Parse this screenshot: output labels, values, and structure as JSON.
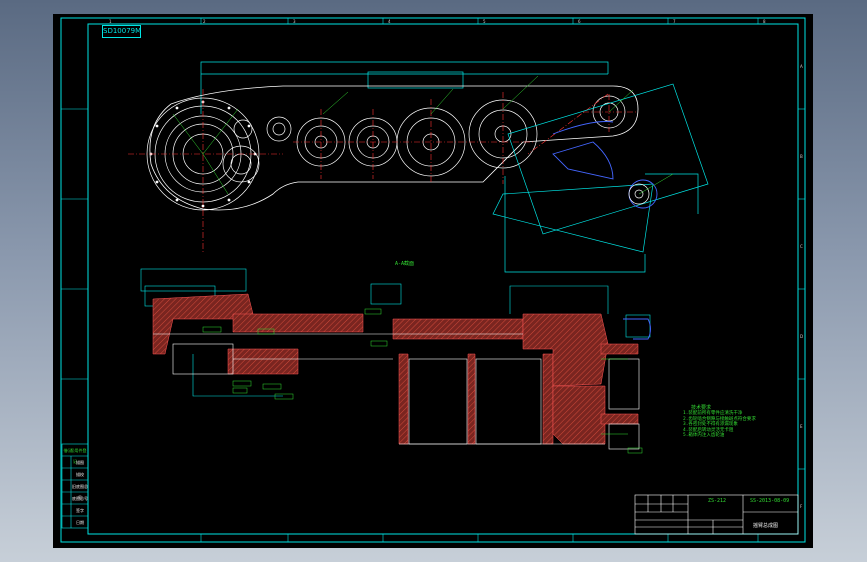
{
  "drawing": {
    "code_box": "SD10079M",
    "section_label": "A-A截面",
    "title_block": {
      "title": "ZS-212",
      "drawing_no": "SS-2013-08-09",
      "name": "摇臂总成图"
    },
    "left_table": {
      "header": "借(通)用件登记",
      "rows": [
        "描图",
        "描校",
        "旧底图总号",
        "底图总号",
        "签字",
        "日期"
      ]
    },
    "notes": {
      "title": "技术要求",
      "lines": [
        "1.装配前所有零件应清洗干净",
        "2.齿轮啮合侧隙与接触斑点符合要求",
        "3.各密封处不得有渗漏现象",
        "4.装配后转动灵活无卡阻",
        "5.箱体内注入齿轮油"
      ]
    },
    "grid_top": [
      "1",
      "2",
      "3",
      "4",
      "5",
      "6",
      "7",
      "8"
    ],
    "grid_side": [
      "A",
      "B",
      "C",
      "D",
      "E",
      "F"
    ]
  },
  "colors": {
    "frame": "#00e5e5",
    "gear": "#ffffff",
    "center": "#ff3333",
    "dim": "#33dd33",
    "hatch": "#b03a2e",
    "blue": "#4466ff"
  }
}
